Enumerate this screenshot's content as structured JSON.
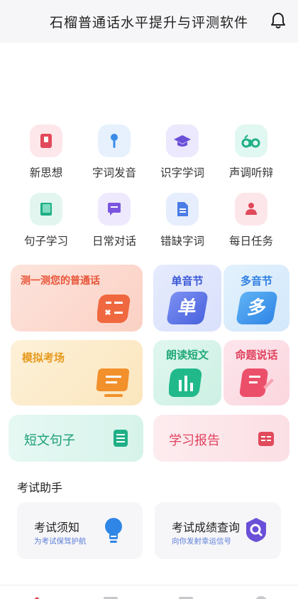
{
  "header": {
    "title": "石榴普通话水平提升与评测软件",
    "bell_icon": "bell-icon"
  },
  "grid": [
    {
      "label": "新思想",
      "icon": "book-icon"
    },
    {
      "label": "字词发音",
      "icon": "microphone-icon"
    },
    {
      "label": "识字学词",
      "icon": "graduation-cap-icon"
    },
    {
      "label": "声调听辩",
      "icon": "tone-icon"
    },
    {
      "label": "句子学习",
      "icon": "notebook-icon"
    },
    {
      "label": "日常对话",
      "icon": "chat-icon"
    },
    {
      "label": "错缺字词",
      "icon": "document-icon"
    },
    {
      "label": "每日任务",
      "icon": "person-icon"
    }
  ],
  "cards": {
    "test": "测一测您的普通话",
    "single": "单音节",
    "multi": "多音节",
    "mock": "模拟考场",
    "read": "朗读短文",
    "topic": "命题说话",
    "short": "短文句子",
    "report": "学习报告"
  },
  "card_glyphs": {
    "single": "单",
    "multi": "多"
  },
  "assistant": {
    "title": "考试助手",
    "items": [
      {
        "title": "考试须知",
        "sub": "为考试保驾护航"
      },
      {
        "title": "考试成绩查询",
        "sub": "向你发射幸运信号"
      }
    ]
  },
  "colors": {
    "accent_blue": "#3b6fe0",
    "accent_orange": "#f07a3a",
    "accent_green": "#21b98a",
    "accent_red": "#e14a5a"
  }
}
